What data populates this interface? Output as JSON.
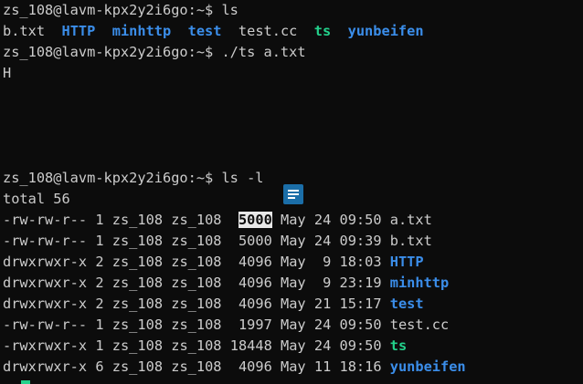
{
  "prompt": "zs_108@lavm-kpx2y2i6go:~$ ",
  "cmd1": "ls",
  "ls_items": [
    {
      "name": "b.txt",
      "kind": "file"
    },
    {
      "name": "HTTP",
      "kind": "dir"
    },
    {
      "name": "minhttp",
      "kind": "dir"
    },
    {
      "name": "test",
      "kind": "dir"
    },
    {
      "name": "test.cc",
      "kind": "file"
    },
    {
      "name": "ts",
      "kind": "exe"
    },
    {
      "name": "yunbeifen",
      "kind": "dir"
    }
  ],
  "cmd2": "./ts a.txt",
  "output": "H",
  "cmd3": "ls -l",
  "total": "total 56",
  "long_rows": [
    {
      "perm": "-rw-rw-r--",
      "links": "1",
      "owner": "zs_108",
      "group": "zs_108",
      "size": " 5000",
      "date": "May 24 09:50",
      "name": "a.txt",
      "kind": "file",
      "selected": true
    },
    {
      "perm": "-rw-rw-r--",
      "links": "1",
      "owner": "zs_108",
      "group": "zs_108",
      "size": " 5000",
      "date": "May 24 09:39",
      "name": "b.txt",
      "kind": "file"
    },
    {
      "perm": "drwxrwxr-x",
      "links": "2",
      "owner": "zs_108",
      "group": "zs_108",
      "size": " 4096",
      "date": "May  9 18:03",
      "name": "HTTP",
      "kind": "dir"
    },
    {
      "perm": "drwxrwxr-x",
      "links": "2",
      "owner": "zs_108",
      "group": "zs_108",
      "size": " 4096",
      "date": "May  9 23:19",
      "name": "minhttp",
      "kind": "dir"
    },
    {
      "perm": "drwxrwxr-x",
      "links": "2",
      "owner": "zs_108",
      "group": "zs_108",
      "size": " 4096",
      "date": "May 21 15:17",
      "name": "test",
      "kind": "dir"
    },
    {
      "perm": "-rw-rw-r--",
      "links": "1",
      "owner": "zs_108",
      "group": "zs_108",
      "size": " 1997",
      "date": "May 24 09:50",
      "name": "test.cc",
      "kind": "file"
    },
    {
      "perm": "-rwxrwxr-x",
      "links": "1",
      "owner": "zs_108",
      "group": "zs_108",
      "size": "18448",
      "date": "May 24 09:50",
      "name": "ts",
      "kind": "exe"
    },
    {
      "perm": "drwxrwxr-x",
      "links": "6",
      "owner": "zs_108",
      "group": "zs_108",
      "size": " 4096",
      "date": "May 11 18:16",
      "name": "yunbeifen",
      "kind": "dir"
    }
  ],
  "colors": {
    "background": "#0c0c0c",
    "text": "#cccccc",
    "dir": "#3b8eea",
    "exe": "#23d18b",
    "icon": "#1b6ea8"
  },
  "icons": {
    "floating": "note-icon",
    "cursor": "block-cursor"
  }
}
